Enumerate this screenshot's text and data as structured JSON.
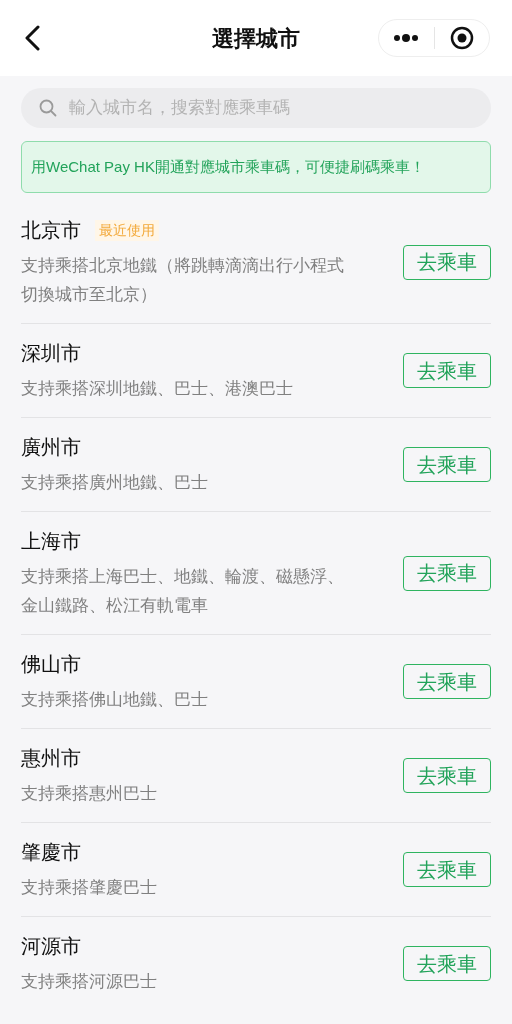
{
  "header": {
    "title": "選擇城市"
  },
  "search": {
    "placeholder": "輸入城市名，搜索對應乘車碼"
  },
  "banner": {
    "text": "用WeChat Pay HK開通對應城市乘車碼，可便捷刷碼乘車！"
  },
  "cities": [
    {
      "name": "北京市",
      "badge": "最近使用",
      "description": "支持乘搭北京地鐵（將跳轉滴滴出行小程式切換城市至北京）",
      "button": "去乘車"
    },
    {
      "name": "深圳市",
      "description": "支持乘搭深圳地鐵、巴士、港澳巴士",
      "button": "去乘車"
    },
    {
      "name": "廣州市",
      "description": "支持乘搭廣州地鐵、巴士",
      "button": "去乘車"
    },
    {
      "name": "上海市",
      "description": "支持乘搭上海巴士、地鐵、輪渡、磁懸浮、金山鐵路、松江有軌電車",
      "button": "去乘車"
    },
    {
      "name": "佛山市",
      "description": "支持乘搭佛山地鐵、巴士",
      "button": "去乘車"
    },
    {
      "name": "惠州市",
      "description": "支持乘搭惠州巴士",
      "button": "去乘車"
    },
    {
      "name": "肇慶市",
      "description": "支持乘搭肇慶巴士",
      "button": "去乘車"
    },
    {
      "name": "河源市",
      "description": "支持乘搭河源巴士",
      "button": "去乘車"
    }
  ]
}
